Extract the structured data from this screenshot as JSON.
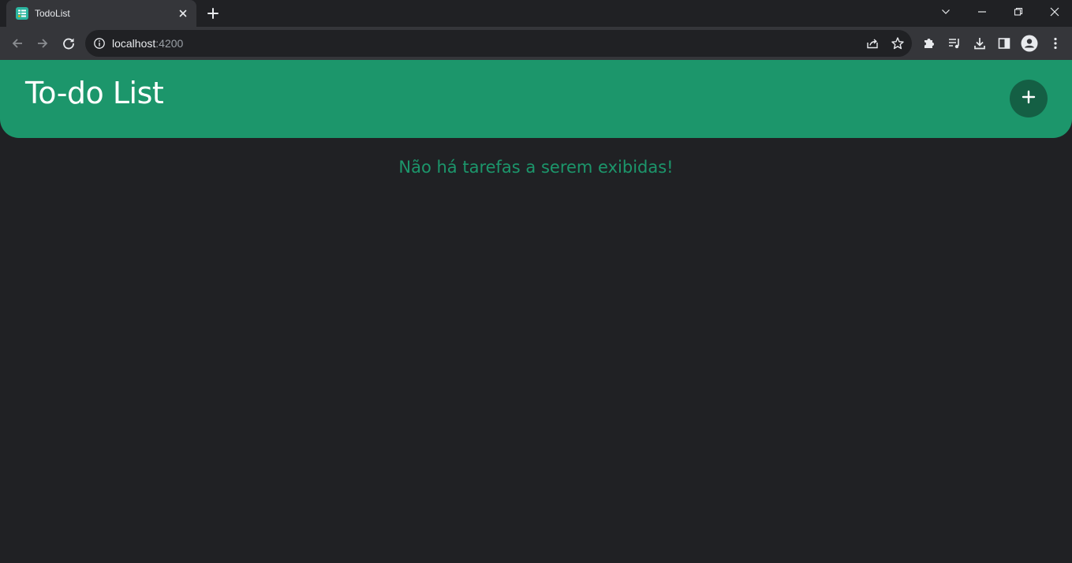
{
  "browser": {
    "tab": {
      "title": "TodoList",
      "favicon": "todolist-favicon-icon",
      "close_icon": "close-icon"
    },
    "new_tab_icon": "plus-icon",
    "window_controls": [
      "chevron-down-icon",
      "minimize-icon",
      "restore-icon",
      "close-icon"
    ],
    "toolbar": {
      "back_icon": "arrow-left-icon",
      "forward_icon": "arrow-right-icon",
      "reload_icon": "reload-icon",
      "url_host": "localhost",
      "url_port": ":4200",
      "info_icon": "info-icon",
      "share_icon": "share-icon",
      "bookmark_icon": "star-icon",
      "extensions_icon": "puzzle-icon",
      "media_icon": "media-queue-icon",
      "download_icon": "download-icon",
      "sidepanel_icon": "side-panel-icon",
      "profile_icon": "profile-icon",
      "menu_icon": "kebab-menu-icon"
    }
  },
  "app": {
    "title": "To-do List",
    "add_button_icon": "plus-icon",
    "empty_message": "Não há tarefas a serem exibidas!",
    "colors": {
      "header": "#1c966b",
      "add_button": "#145f44",
      "background": "#202124",
      "message": "#1c966b"
    }
  }
}
